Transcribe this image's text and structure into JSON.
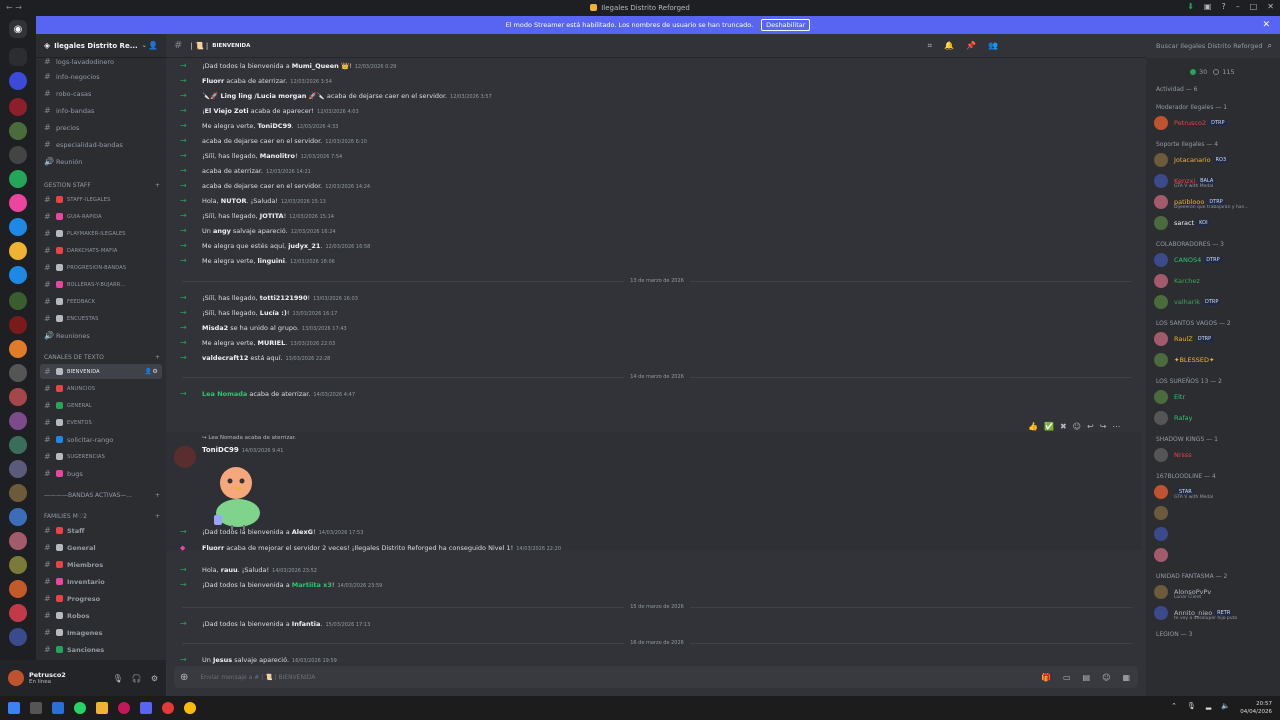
{
  "window": {
    "title": "Ilegales Distrito Reforged"
  },
  "banner": {
    "text": "El modo Streamer está habilitado. Los nombres de usuario se han truncado.",
    "button": "Deshabilitar"
  },
  "server": {
    "name": "Ilegales Distrito Re..."
  },
  "channels": {
    "top": [
      "logs-lavadodinero",
      "info-negocios",
      "robo-casas",
      "info-bandas",
      "precios",
      "especialidad-bandas",
      "Reunión"
    ],
    "cat_staff": "GESTION STAFF",
    "staff": [
      "STAFF-ILEGALES",
      "GUIA-RAPIDA",
      "PLAYMAKER-ILEGALES",
      "DARKCHATS-MAFIA",
      "PROGRESION-BANDAS",
      "BOLLERAS-Y-BUJARR...",
      "FEEDBACK",
      "ENCUESTAS",
      "Reuniones"
    ],
    "cat_text": "CANALES DE TEXTO",
    "text": [
      "BIENVENIDA",
      "ANUNCIOS",
      "GENERAL",
      "EVENTOS",
      "solicitar-rango",
      "SUGERENCIAS",
      "bugs"
    ],
    "cat_bandas": "————BANDAS ACTIVAS—...",
    "cat_families": "FAMILIES M♡2",
    "families": [
      "Staff",
      "General",
      "Miembros",
      "Inventario",
      "Progreso",
      "Robos",
      "Imagenes",
      "Sanciones"
    ]
  },
  "user": {
    "name": "Petrusco2",
    "status": "En línea"
  },
  "chat": {
    "channel": "BIENVENIDA",
    "search": "Buscar Ilegales Distrito Reforged",
    "composer_placeholder": "Enviar mensaje a # | 📜 | BIENVENIDA",
    "messages": [
      {
        "pre": "¡Dad todos la bienvenida a ",
        "name": "Mumi_Queen 👑",
        "post": "!",
        "ts": "12/03/2026 0:29"
      },
      {
        "pre": "",
        "name": "Fluorr",
        "post": " acaba de aterrizar.",
        "ts": "12/03/2026 3:54"
      },
      {
        "pre": "",
        "name": "🔪🚀 Ling ling /Lucia morgan 🚀🔪",
        "post": " acaba de dejarse caer en el servidor.",
        "ts": "12/03/2026 3:57"
      },
      {
        "pre": "¡",
        "name": "El Viejo Zoti",
        "post": " acaba de aparecer!",
        "ts": "12/03/2026 4:03"
      },
      {
        "pre": "Me alegra verte, ",
        "name": "ToniDC99",
        "post": ".",
        "ts": "12/03/2026 4:33"
      },
      {
        "pre": "",
        "name": "",
        "post": " acaba de dejarse caer en el servidor.",
        "ts": "12/03/2026 6:10"
      },
      {
        "pre": "¡Sííí, has llegado, ",
        "name": "Manolitro",
        "post": "!",
        "ts": "12/03/2026 7:54"
      },
      {
        "pre": "",
        "name": "",
        "post": " acaba de aterrizar.",
        "ts": "12/03/2026 14:21"
      },
      {
        "pre": "",
        "name": "",
        "post": " acaba de dejarse caer en el servidor.",
        "ts": "12/03/2026 14:24"
      },
      {
        "pre": "Hola, ",
        "name": "NUTOR",
        "post": ". ¡Saluda!",
        "ts": "12/03/2026 15:13"
      },
      {
        "pre": "¡Sííí, has llegado, ",
        "name": "JOTITA",
        "post": "!",
        "ts": "12/03/2026 15:14"
      },
      {
        "pre": "Un ",
        "name": "angy",
        "post": " salvaje apareció.",
        "ts": "12/03/2026 16:24"
      },
      {
        "pre": "Me alegra que estés aquí, ",
        "name": "judyx_21",
        "post": ".",
        "ts": "12/03/2026 16:58"
      },
      {
        "pre": "Me alegra verte, ",
        "name": "linguini",
        "post": ".",
        "ts": "12/03/2026 18:06"
      }
    ],
    "sep1": "13 de marzo de 2026",
    "messages2": [
      {
        "pre": "¡Sííí, has llegado, ",
        "name": "totti2121990",
        "post": "!",
        "ts": "13/03/2026 16:03"
      },
      {
        "pre": "¡Sííí, has llegado, ",
        "name": "Lucía :)",
        "post": "!",
        "ts": "13/03/2026 16:17"
      },
      {
        "pre": "",
        "name": "Misda2",
        "post": " se ha unido al grupo.",
        "ts": "13/03/2026 17:43"
      },
      {
        "pre": "Me alegra verte, ",
        "name": "MURIEL",
        "post": ".",
        "ts": "13/03/2026 22:03"
      },
      {
        "pre": "",
        "name": "valdecraft12",
        "post": " está aquí.",
        "ts": "13/03/2026 22:28"
      }
    ],
    "sep2": "14 de marzo de 2026",
    "lea": {
      "name": "Lea Nomada",
      "post": " acaba de aterrizar.",
      "ts": "14/03/2026 4:47"
    },
    "reply": "Lea Nomada acaba de aterrizar.",
    "rich": {
      "name": "ToniDC99",
      "ts": "14/03/2026 9:41"
    },
    "messages3": [
      {
        "pre": "¡Dad todos la bienvenida a ",
        "name": "AlexG",
        "post": "!",
        "ts": "14/03/2026 17:53"
      },
      {
        "pre": "",
        "name": "Fluorr",
        "post": " acaba de mejorar el servidor 2 veces! ¡Ilegales Distrito Reforged ha conseguido Nivel 1!",
        "ts": "14/03/2026 22:20"
      },
      {
        "pre": "Hola, ",
        "name": "rauu",
        "post": ". ¡Saluda!",
        "ts": "14/03/2026 23:52"
      },
      {
        "pre": "¡Dad todos la bienvenida a ",
        "name": "Martiita x3",
        "post": "!",
        "ts": "14/03/2026 23:59"
      }
    ],
    "sep3": "15 de marzo de 2026",
    "infantia": {
      "pre": "¡Dad todos la bienvenida a ",
      "name": "Infantia",
      "post": ".",
      "ts": "15/03/2026 17:13"
    },
    "sep4": "16 de marzo de 2026",
    "jesus": {
      "pre": "Un ",
      "name": "Jesus",
      "post": " salvaje apareció.",
      "ts": "16/03/2026 19:59"
    }
  },
  "members": {
    "online": "30",
    "total": "115",
    "activity": "Actividad — 6",
    "groups": [
      {
        "label": "Moderador Ilegales — 1",
        "items": [
          {
            "name": "Petrusco2",
            "tag": "DTRP",
            "color": "#ed4245"
          }
        ]
      },
      {
        "label": "Soporte Ilegales — 4",
        "items": [
          {
            "name": "Jotacanario",
            "tag": "RO3",
            "color": "#f0b232"
          },
          {
            "name": "Kenzxi",
            "tag": "BALA",
            "color": "#ed4245",
            "sub": "GTA V with Medal"
          },
          {
            "name": "patiblooo",
            "tag": "DTRP",
            "color": "#f0b232",
            "sub": "Dijeeeron que trabajaran y han..."
          },
          {
            "name": "saract",
            "tag": "KOI",
            "color": "#f2f3f5"
          }
        ]
      },
      {
        "label": "COLABORADORES — 3",
        "items": [
          {
            "name": "CANOS4",
            "tag": "DTRP",
            "color": "#2dc770"
          },
          {
            "name": "Karchez",
            "tag": "",
            "color": "#3ba55c"
          },
          {
            "name": "valharik",
            "tag": "DTRP",
            "color": "#3ba55c"
          }
        ]
      },
      {
        "label": "LOS SANTOS VAGOS — 2",
        "items": [
          {
            "name": "RaulZ",
            "tag": "DTRP",
            "color": "#f0b232"
          },
          {
            "name": "✦BLESSED✦",
            "tag": "",
            "color": "#f0b232"
          }
        ]
      },
      {
        "label": "LOS SUREÑOS 13 — 2",
        "items": [
          {
            "name": "Eltr",
            "tag": "",
            "color": "#2dc770"
          },
          {
            "name": "Rafay",
            "tag": "",
            "color": "#2dc770"
          }
        ]
      },
      {
        "label": "SHADOW KINGS — 1",
        "items": [
          {
            "name": "Nrsss",
            "tag": "",
            "color": "#ed4245"
          }
        ]
      },
      {
        "label": "167BLOODLINE — 4",
        "items": [
          {
            "name": "",
            "tag": "STAR",
            "color": "#ed4245",
            "sub": "GTA V with Medal"
          },
          {
            "name": "",
            "tag": "",
            "color": "#ed4245"
          },
          {
            "name": "",
            "tag": "",
            "color": "#ed4245"
          },
          {
            "name": "",
            "tag": "",
            "color": "#ed4245"
          }
        ]
      },
      {
        "label": "UNIDAD FANTASMA — 2",
        "items": [
          {
            "name": "AlonsoPvPv",
            "tag": "",
            "color": "#b5bac1",
            "sub": "Lunar Client"
          },
          {
            "name": "Annito_nieo",
            "tag": "RETR",
            "color": "#b5bac1",
            "sub": "te voy a desoluper hijo puta"
          }
        ]
      },
      {
        "label": "LEGION — 3",
        "items": []
      }
    ]
  },
  "clock": {
    "time": "20:57",
    "date": "04/04/2026"
  },
  "colors": {
    "accent": "#5865f2",
    "green": "#23a55a",
    "bg": "#313338"
  }
}
